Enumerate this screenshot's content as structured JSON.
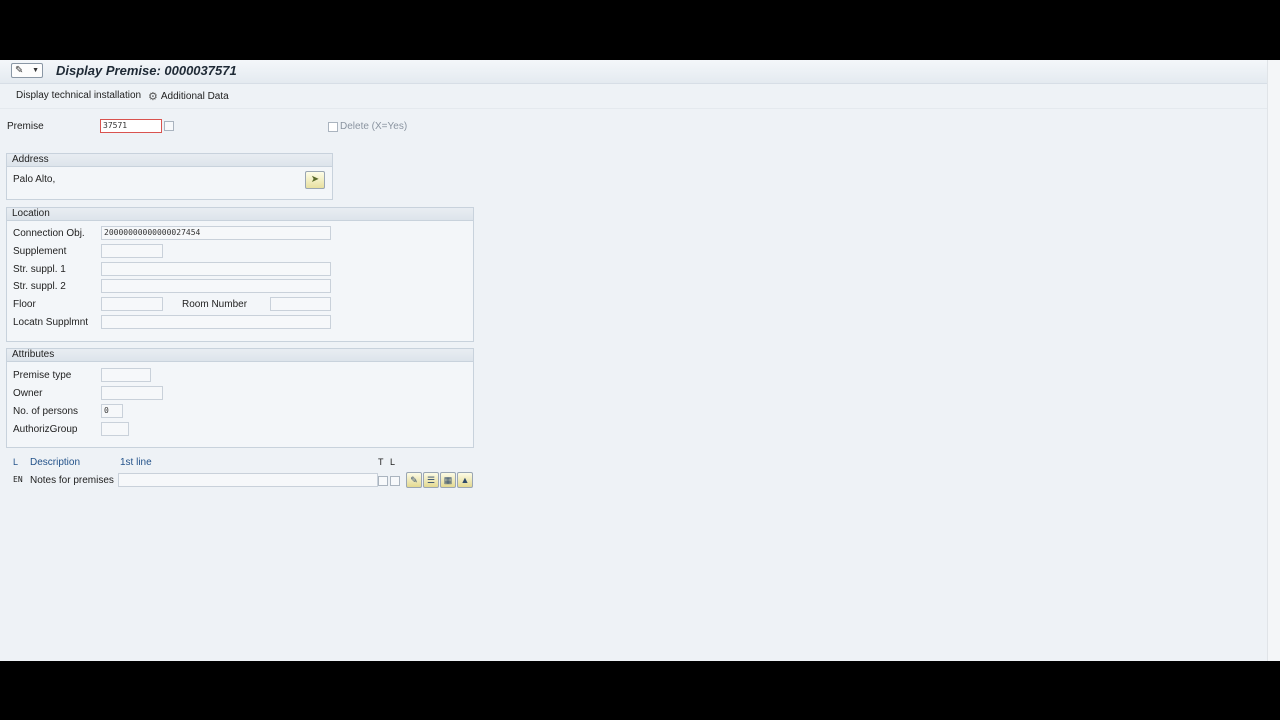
{
  "window": {
    "title": "Display Premise: 0000037571"
  },
  "toolbar": {
    "display_tech_label": "Display technical installation",
    "additional_data_label": "Additional Data"
  },
  "header": {
    "premise_label": "Premise",
    "premise_value": "37571",
    "delete_label": "Delete (X=Yes)"
  },
  "address": {
    "title": "Address",
    "value": "Palo Alto,"
  },
  "location": {
    "title": "Location",
    "connection_label": "Connection Obj.",
    "connection_value": "20000000000000027454",
    "supplement_label": "Supplement",
    "str_suppl1_label": "Str. suppl. 1",
    "str_suppl2_label": "Str. suppl. 2",
    "floor_label": "Floor",
    "room_label": "Room Number",
    "locatn_label": "Locatn Supplmnt"
  },
  "attributes": {
    "title": "Attributes",
    "premise_type_label": "Premise type",
    "owner_label": "Owner",
    "persons_label": "No. of persons",
    "persons_value": "0",
    "authgroup_label": "AuthorizGroup"
  },
  "notes": {
    "lang_header": "L",
    "desc_header": "Description",
    "first_line_header": "1st line",
    "t_header": "T",
    "l_header": "L",
    "lang_code": "EN",
    "row_label": "Notes for premises"
  },
  "colors": {
    "accent": "#24538a",
    "screen_bg": "#eef2f6"
  }
}
